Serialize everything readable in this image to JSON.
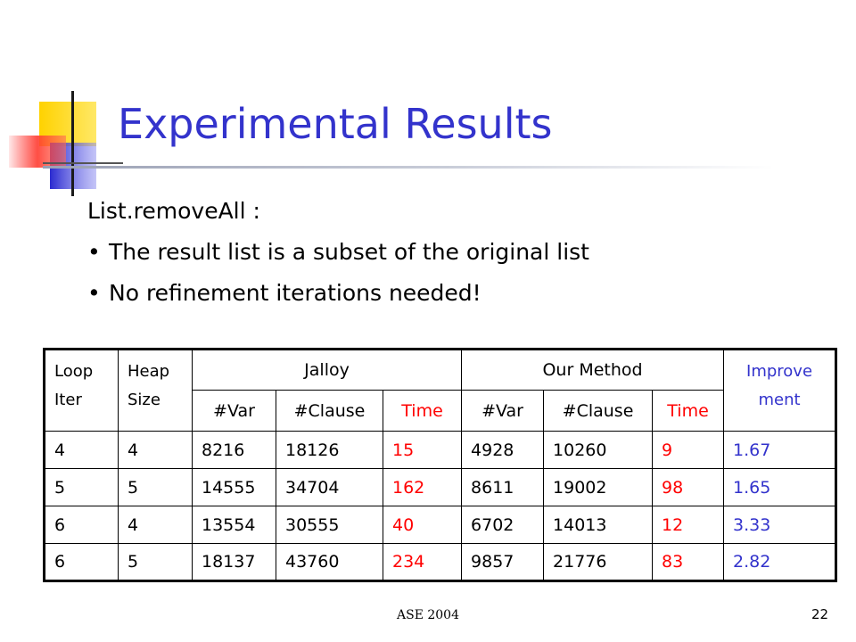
{
  "title": "Experimental Results",
  "heading": "List.removeAll :",
  "bullets": [
    "The result list is a subset of the original list",
    "No refinement iterations needed!"
  ],
  "table": {
    "h_loop_1": "Loop",
    "h_loop_2": "Iter",
    "h_heap_1": "Heap",
    "h_heap_2": "Size",
    "h_jalloy": "Jalloy",
    "h_ourmethod": "Our Method",
    "h_improve_1": "Improve",
    "h_improve_2": "ment",
    "sub_var": "#Var",
    "sub_clause": "#Clause",
    "sub_time": "Time",
    "rows": [
      [
        "4",
        "4",
        "8216",
        "18126",
        "15",
        "4928",
        "10260",
        "9",
        "1.67"
      ],
      [
        "5",
        "5",
        "14555",
        "34704",
        "162",
        "8611",
        "19002",
        "98",
        "1.65"
      ],
      [
        "6",
        "4",
        "13554",
        "30555",
        "40",
        "6702",
        "14013",
        "12",
        "3.33"
      ],
      [
        "6",
        "5",
        "18137",
        "43760",
        "234",
        "9857",
        "21776",
        "83",
        "2.82"
      ]
    ]
  },
  "footer": "ASE 2004",
  "page_number": "22",
  "colors": {
    "title": "#3333cc",
    "time_values": "#ff0000",
    "improvement_values": "#3333cc"
  }
}
